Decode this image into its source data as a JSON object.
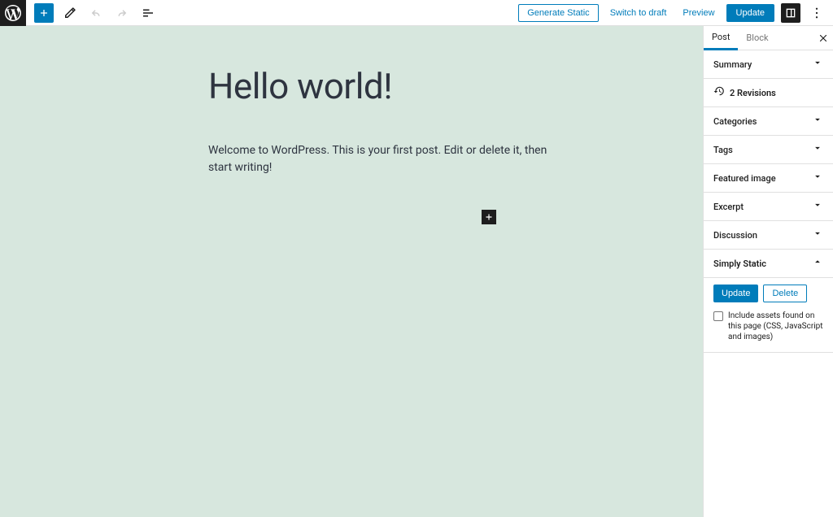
{
  "toolbar": {
    "generate_static": "Generate Static",
    "switch_to_draft": "Switch to draft",
    "preview": "Preview",
    "update": "Update"
  },
  "post": {
    "title": "Hello world!",
    "body": "Welcome to WordPress. This is your first post. Edit or delete it, then start writing!"
  },
  "sidebar": {
    "tabs": {
      "post": "Post",
      "block": "Block"
    },
    "sections": {
      "summary": "Summary",
      "revisions": "2 Revisions",
      "categories": "Categories",
      "tags": "Tags",
      "featured_image": "Featured image",
      "excerpt": "Excerpt",
      "discussion": "Discussion",
      "simply_static": "Simply Static"
    },
    "simply_static": {
      "update": "Update",
      "delete": "Delete",
      "checkbox_label": "Include assets found on this page (CSS, JavaScript and images)"
    }
  }
}
